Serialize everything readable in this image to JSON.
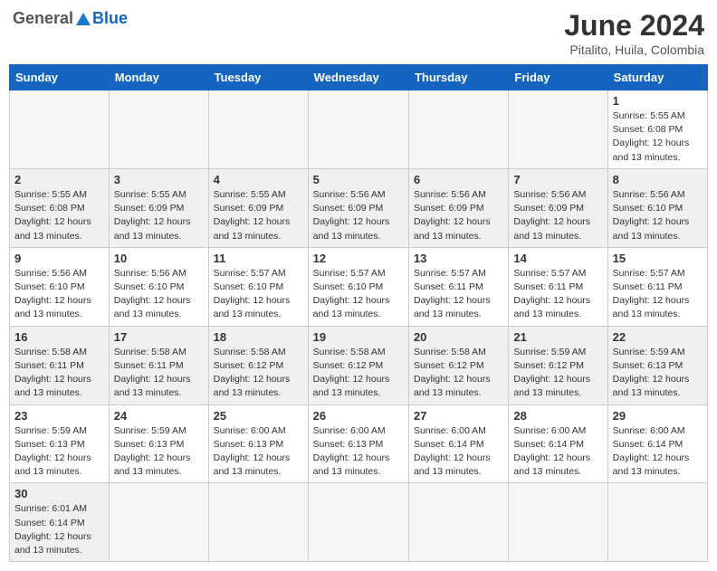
{
  "header": {
    "logo_general": "General",
    "logo_blue": "Blue",
    "title": "June 2024",
    "subtitle": "Pitalito, Huila, Colombia"
  },
  "weekdays": [
    "Sunday",
    "Monday",
    "Tuesday",
    "Wednesday",
    "Thursday",
    "Friday",
    "Saturday"
  ],
  "weeks": [
    [
      {
        "day": "",
        "info": ""
      },
      {
        "day": "",
        "info": ""
      },
      {
        "day": "",
        "info": ""
      },
      {
        "day": "",
        "info": ""
      },
      {
        "day": "",
        "info": ""
      },
      {
        "day": "",
        "info": ""
      },
      {
        "day": "1",
        "info": "Sunrise: 5:55 AM\nSunset: 6:08 PM\nDaylight: 12 hours and 13 minutes."
      }
    ],
    [
      {
        "day": "2",
        "info": "Sunrise: 5:55 AM\nSunset: 6:08 PM\nDaylight: 12 hours and 13 minutes."
      },
      {
        "day": "3",
        "info": "Sunrise: 5:55 AM\nSunset: 6:09 PM\nDaylight: 12 hours and 13 minutes."
      },
      {
        "day": "4",
        "info": "Sunrise: 5:55 AM\nSunset: 6:09 PM\nDaylight: 12 hours and 13 minutes."
      },
      {
        "day": "5",
        "info": "Sunrise: 5:56 AM\nSunset: 6:09 PM\nDaylight: 12 hours and 13 minutes."
      },
      {
        "day": "6",
        "info": "Sunrise: 5:56 AM\nSunset: 6:09 PM\nDaylight: 12 hours and 13 minutes."
      },
      {
        "day": "7",
        "info": "Sunrise: 5:56 AM\nSunset: 6:09 PM\nDaylight: 12 hours and 13 minutes."
      },
      {
        "day": "8",
        "info": "Sunrise: 5:56 AM\nSunset: 6:10 PM\nDaylight: 12 hours and 13 minutes."
      }
    ],
    [
      {
        "day": "9",
        "info": "Sunrise: 5:56 AM\nSunset: 6:10 PM\nDaylight: 12 hours and 13 minutes."
      },
      {
        "day": "10",
        "info": "Sunrise: 5:56 AM\nSunset: 6:10 PM\nDaylight: 12 hours and 13 minutes."
      },
      {
        "day": "11",
        "info": "Sunrise: 5:57 AM\nSunset: 6:10 PM\nDaylight: 12 hours and 13 minutes."
      },
      {
        "day": "12",
        "info": "Sunrise: 5:57 AM\nSunset: 6:10 PM\nDaylight: 12 hours and 13 minutes."
      },
      {
        "day": "13",
        "info": "Sunrise: 5:57 AM\nSunset: 6:11 PM\nDaylight: 12 hours and 13 minutes."
      },
      {
        "day": "14",
        "info": "Sunrise: 5:57 AM\nSunset: 6:11 PM\nDaylight: 12 hours and 13 minutes."
      },
      {
        "day": "15",
        "info": "Sunrise: 5:57 AM\nSunset: 6:11 PM\nDaylight: 12 hours and 13 minutes."
      }
    ],
    [
      {
        "day": "16",
        "info": "Sunrise: 5:58 AM\nSunset: 6:11 PM\nDaylight: 12 hours and 13 minutes."
      },
      {
        "day": "17",
        "info": "Sunrise: 5:58 AM\nSunset: 6:11 PM\nDaylight: 12 hours and 13 minutes."
      },
      {
        "day": "18",
        "info": "Sunrise: 5:58 AM\nSunset: 6:12 PM\nDaylight: 12 hours and 13 minutes."
      },
      {
        "day": "19",
        "info": "Sunrise: 5:58 AM\nSunset: 6:12 PM\nDaylight: 12 hours and 13 minutes."
      },
      {
        "day": "20",
        "info": "Sunrise: 5:58 AM\nSunset: 6:12 PM\nDaylight: 12 hours and 13 minutes."
      },
      {
        "day": "21",
        "info": "Sunrise: 5:59 AM\nSunset: 6:12 PM\nDaylight: 12 hours and 13 minutes."
      },
      {
        "day": "22",
        "info": "Sunrise: 5:59 AM\nSunset: 6:13 PM\nDaylight: 12 hours and 13 minutes."
      }
    ],
    [
      {
        "day": "23",
        "info": "Sunrise: 5:59 AM\nSunset: 6:13 PM\nDaylight: 12 hours and 13 minutes."
      },
      {
        "day": "24",
        "info": "Sunrise: 5:59 AM\nSunset: 6:13 PM\nDaylight: 12 hours and 13 minutes."
      },
      {
        "day": "25",
        "info": "Sunrise: 6:00 AM\nSunset: 6:13 PM\nDaylight: 12 hours and 13 minutes."
      },
      {
        "day": "26",
        "info": "Sunrise: 6:00 AM\nSunset: 6:13 PM\nDaylight: 12 hours and 13 minutes."
      },
      {
        "day": "27",
        "info": "Sunrise: 6:00 AM\nSunset: 6:14 PM\nDaylight: 12 hours and 13 minutes."
      },
      {
        "day": "28",
        "info": "Sunrise: 6:00 AM\nSunset: 6:14 PM\nDaylight: 12 hours and 13 minutes."
      },
      {
        "day": "29",
        "info": "Sunrise: 6:00 AM\nSunset: 6:14 PM\nDaylight: 12 hours and 13 minutes."
      }
    ],
    [
      {
        "day": "30",
        "info": "Sunrise: 6:01 AM\nSunset: 6:14 PM\nDaylight: 12 hours and 13 minutes."
      },
      {
        "day": "",
        "info": ""
      },
      {
        "day": "",
        "info": ""
      },
      {
        "day": "",
        "info": ""
      },
      {
        "day": "",
        "info": ""
      },
      {
        "day": "",
        "info": ""
      },
      {
        "day": "",
        "info": ""
      }
    ]
  ]
}
